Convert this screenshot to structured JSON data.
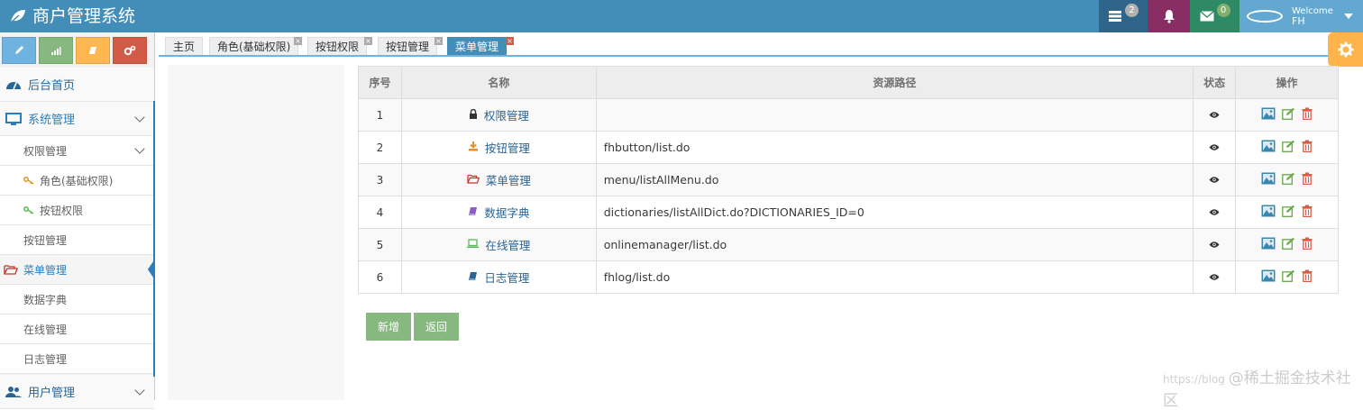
{
  "app": {
    "title": "商户管理系统"
  },
  "navbar": {
    "tasks_count": "2",
    "mail_count": "0",
    "user_welcome": "Welcome",
    "user_name": "FH"
  },
  "sidebar": {
    "home": "后台首页",
    "system": "系统管理",
    "perm": "权限管理",
    "role": "角色(基础权限)",
    "button_perm": "按钮权限",
    "button_mgmt": "按钮管理",
    "menu_mgmt": "菜单管理",
    "dict": "数据字典",
    "online": "在线管理",
    "log": "日志管理",
    "users": "用户管理"
  },
  "tabs": [
    "主页",
    "角色(基础权限)",
    "按钮权限",
    "按钮管理",
    "菜单管理"
  ],
  "table": {
    "headers": [
      "序号",
      "名称",
      "资源路径",
      "状态",
      "操作"
    ],
    "rows": [
      {
        "no": "1",
        "icon": "lock-icon",
        "color": "#333333",
        "name": "权限管理",
        "path": ""
      },
      {
        "no": "2",
        "icon": "download-icon",
        "color": "#e8902c",
        "name": "按钮管理",
        "path": "fhbutton/list.do"
      },
      {
        "no": "3",
        "icon": "folder-open-icon",
        "color": "#c9302c",
        "name": "菜单管理",
        "path": "menu/listAllMenu.do"
      },
      {
        "no": "4",
        "icon": "book-icon",
        "color": "#8e5cc8",
        "name": "数据字典",
        "path": "dictionaries/listAllDict.do?DICTIONARIES_ID=0"
      },
      {
        "no": "5",
        "icon": "laptop-icon",
        "color": "#5cb85c",
        "name": "在线管理",
        "path": "onlinemanager/list.do"
      },
      {
        "no": "6",
        "icon": "book-icon",
        "color": "#2a6496",
        "name": "日志管理",
        "path": "fhlog/list.do"
      }
    ]
  },
  "buttons": {
    "add": "新增",
    "back": "返回"
  },
  "watermark": {
    "prefix": "https://blog",
    "brand": "@稀土掘金技术社区"
  },
  "colors": {
    "navbar": "#438eb9",
    "accent": "#2b7dbc",
    "button": "#87b87f"
  }
}
